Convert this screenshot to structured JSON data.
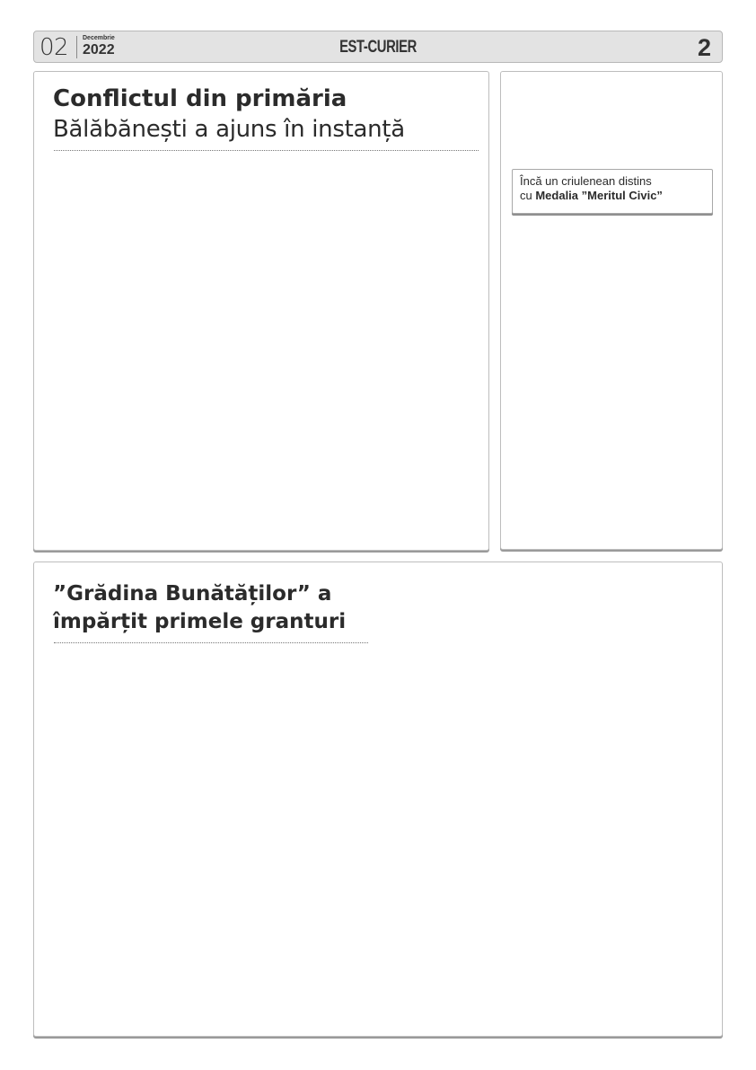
{
  "header": {
    "day": "02",
    "month": "Decembrie",
    "year": "2022",
    "publication": "EST-CURIER",
    "page_number": "2"
  },
  "main_article": {
    "title_line1": "Conflictul din primăria",
    "title_line2": "Bălăbănești a ajuns în instanță"
  },
  "side_box": {
    "callout_line1": "Încă un criulenean distins",
    "callout_line2_prefix": "cu ",
    "callout_line2_bold": "Medalia ”Meritul Civic”"
  },
  "bottom_article": {
    "title_line1": "”Grădina Bunătăților” a",
    "title_line2": "împărțit primele granturi"
  },
  "colors": {
    "header_background": "#e3e3e3",
    "border": "#bdbdbd",
    "text": "#2b2b2b"
  }
}
